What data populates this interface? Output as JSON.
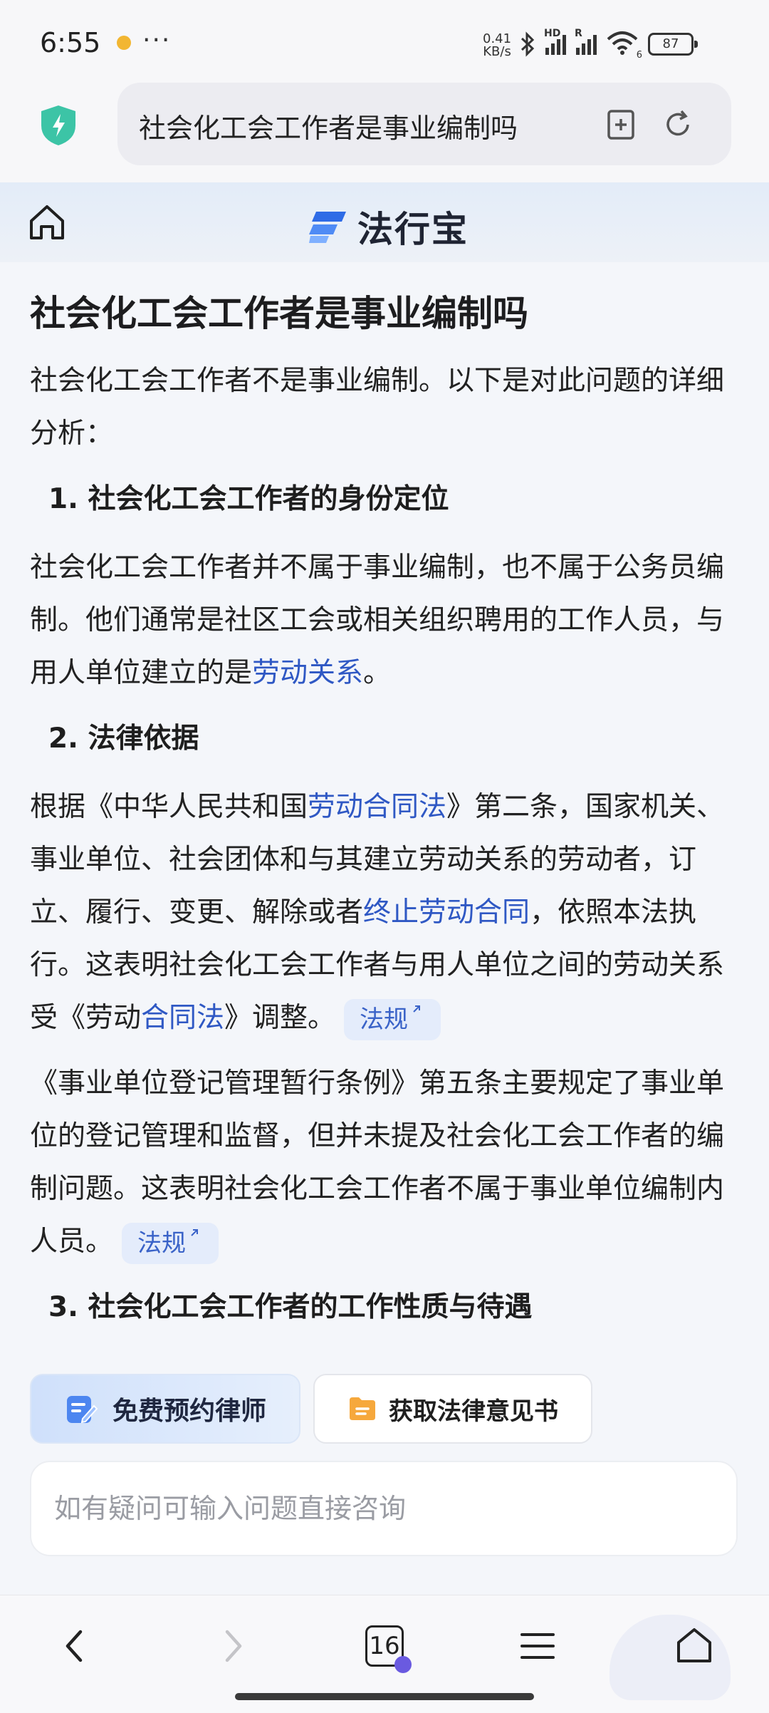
{
  "status_bar": {
    "time": "6:55",
    "dots": "···",
    "net_speed_value": "0.41",
    "net_speed_unit": "KB/s",
    "sim1_tag": "HD",
    "sim2_tag": "R",
    "wifi_sub": "6",
    "battery": "87"
  },
  "browser": {
    "url_text": "社会化工会工作者是事业编制吗"
  },
  "site": {
    "brand_name": "法行宝"
  },
  "article": {
    "title": "社会化工会工作者是事业编制吗",
    "intro": "社会化工会工作者不是事业编制。以下是对此问题的详细分析：",
    "s1_heading": "1. 社会化工会工作者的身份定位",
    "s1_p1_a": "社会化工会工作者并不属于事业编制，也不属于公务员编制。他们通常是社区工会或相关组织聘用的工作人员，与用人单位建立的是",
    "s1_p1_link": "劳动关系",
    "s1_p1_b": "。",
    "s2_heading": "2. 法律依据",
    "s2_p1_a": "根据《中华人民共和国",
    "s2_p1_link1": "劳动合同法",
    "s2_p1_b": "》第二条，国家机关、事业单位、社会团体和与其建立劳动关系的劳动者，订立、履行、变更、解除或者",
    "s2_p1_link2": "终止劳动合同",
    "s2_p1_c": "，依照本法执行。这表明社会化工会工作者与用人单位之间的劳动关系受《劳动",
    "s2_p1_link3": "合同法",
    "s2_p1_d": "》调整。",
    "law_tag": "法规",
    "s2_p2": "《事业单位登记管理暂行条例》第五条主要规定了事业单位的登记管理和监督，但并未提及社会化工会工作者的编制问题。这表明社会化工会工作者不属于事业单位编制内人员。",
    "s3_heading": "3. 社会化工会工作者的工作性质与待遇"
  },
  "actions": {
    "lawyer_button": "免费预约律师",
    "opinion_button": "获取法律意见书"
  },
  "ask": {
    "placeholder": "如有疑问可输入问题直接咨询"
  },
  "bottom_nav": {
    "tab_count": "16"
  },
  "colors": {
    "link": "#2f58c4",
    "law_tag_bg": "#e4ecfb",
    "shield": "#3cc4a6",
    "brand_blue": "#2e6be6"
  }
}
